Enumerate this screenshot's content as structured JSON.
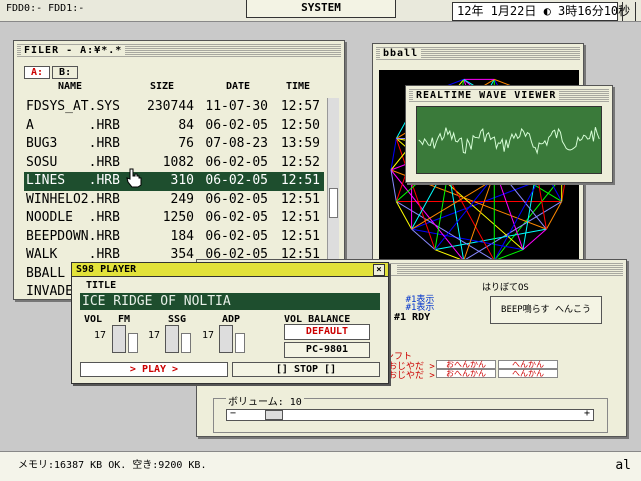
{
  "topbar": {
    "fdd": "FDD0:- FDD1:-",
    "system_tab": "SYSTEM",
    "clock": "12年 1月22日 ◐ 3時16分10秒"
  },
  "filer": {
    "title": "FILER - A:¥*.*",
    "tabs": [
      "A:",
      "B:"
    ],
    "headers": {
      "name": "NAME",
      "size": "SIZE",
      "date": "DATE",
      "time": "TIME"
    },
    "files": [
      {
        "name": "FDSYS_AT.SYS",
        "size": "230744",
        "date": "11-07-30",
        "time": "12:57"
      },
      {
        "name": "A       .HRB",
        "size": "84",
        "date": "06-02-05",
        "time": "12:50"
      },
      {
        "name": "BUG3    .HRB",
        "size": "76",
        "date": "07-08-23",
        "time": "13:59"
      },
      {
        "name": "SOSU    .HRB",
        "size": "1082",
        "date": "06-02-05",
        "time": "12:52"
      },
      {
        "name": "LINES   .HRB",
        "size": "310",
        "date": "06-02-05",
        "time": "12:51"
      },
      {
        "name": "WINHELO2.HRB",
        "size": "249",
        "date": "06-02-05",
        "time": "12:51"
      },
      {
        "name": "NOODLE  .HRB",
        "size": "1250",
        "date": "06-02-05",
        "time": "12:51"
      },
      {
        "name": "BEEPDOWN.HRB",
        "size": "184",
        "date": "06-02-05",
        "time": "12:51"
      },
      {
        "name": "WALK    .HRB",
        "size": "354",
        "date": "06-02-05",
        "time": "12:51"
      },
      {
        "name": "BBALL",
        "size": "",
        "date": "",
        "time": ""
      },
      {
        "name": "INVADE",
        "size": "",
        "date": "",
        "time": ""
      }
    ],
    "selected_index": 4
  },
  "bball": {
    "title": "bball"
  },
  "wave": {
    "title": "REALTIME WAVE VIEWER"
  },
  "control": {
    "slot1": "#1表示",
    "slot2": "#1表示",
    "rdy": "#1 RDY",
    "hari_label": "はりぼてOS",
    "beep_button": "BEEP鳴らす へんこう",
    "shift_label": "おじらシフト",
    "row1_a": "おじやだ >",
    "row2_a": "おじやだ >",
    "cell_a1": "おへんかん",
    "cell_a2": "おへんかん",
    "cell_b1": "へんかん",
    "cell_b2": "へんかん",
    "volume_label": "ボリューム: 10",
    "volume_value": 10,
    "minus": "−",
    "plus": "+"
  },
  "player": {
    "title": "S98 PLAYER",
    "close": "×",
    "title_label": "TITLE",
    "song": "ICE RIDGE OF NOLTIA",
    "vol_label": "VOL",
    "fm_label": "FM",
    "ssg_label": "SSG",
    "adp_label": "ADP",
    "fm_value": "17",
    "ssg_value": "17",
    "adp_value": "17",
    "balance_label": "VOL BALANCE",
    "default_button": "DEFAULT",
    "pc_button": "PC-9801",
    "play_button": "> PLAY >",
    "stop_button": "[] STOP []"
  },
  "status": {
    "text": "メモリ:16387 KB OK. 空き:9200 KB.",
    "ime": "al"
  }
}
